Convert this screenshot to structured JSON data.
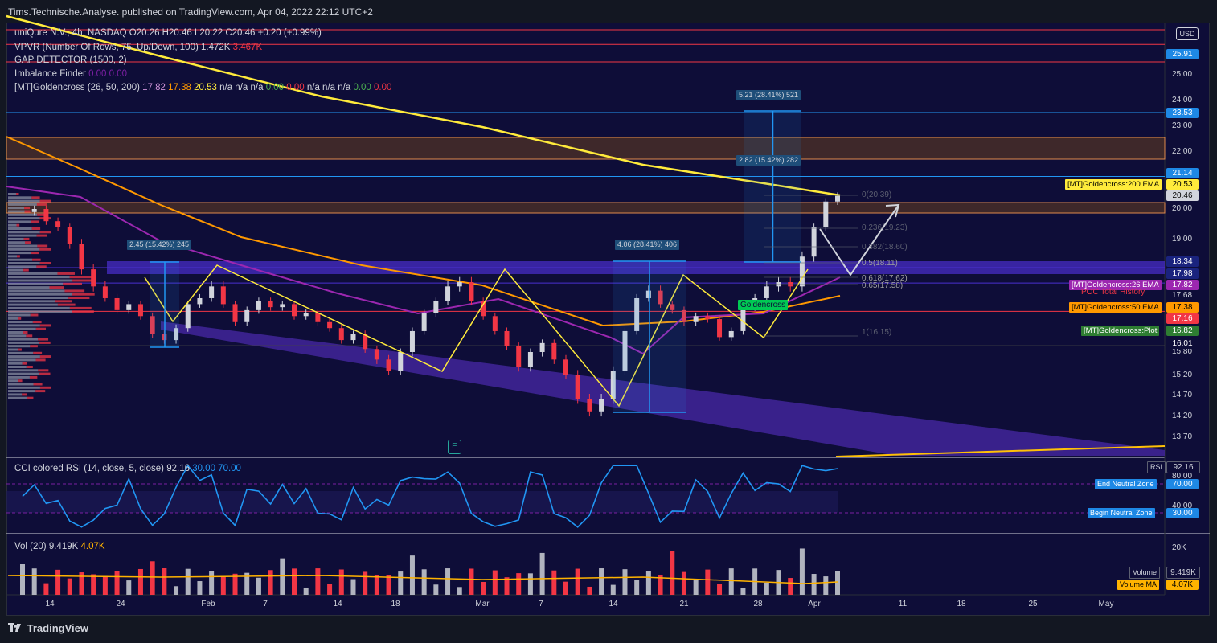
{
  "header": {
    "published": "Tims.Technische.Analyse. published on TradingView.com, Apr 04, 2022 22:12 UTC+2"
  },
  "footer": {
    "brand": "TradingView"
  },
  "legend": {
    "symbol": "uniQure N.V., 4h, NASDAQ",
    "ohlc": "O20.26  H20.46  L20.22  C20.46  +0.20 (+0.99%)",
    "vpvr_label": "VPVR (Number Of Rows, 75, Up/Down, 100)",
    "vpvr_up": "1.472K",
    "vpvr_down": "3.467K",
    "gap": "GAP DETECTOR (1500, 2)",
    "imbalance_label": "Imbalance Finder",
    "imbalance_values": "0.00  0.00",
    "gc_label": "[MT]Goldencross (26, 50, 200)",
    "gc_v1": "17.82",
    "gc_v2": "17.38",
    "gc_v3": "20.53",
    "gc_rest": "n/a  n/a  n/a",
    "gc_v4": "0.00",
    "gc_v5": "0.00",
    "gc_rest2": "n/a  n/a  n/a",
    "gc_v6": "0.00",
    "gc_v7": "0.00"
  },
  "rsi_legend": {
    "label": "CCI colored RSI (14, close, 5, close)",
    "v1": "92.16",
    "v2": "30.00",
    "v3": "70.00"
  },
  "vol_legend": {
    "label": "Vol (20)",
    "v1": "9.419K",
    "v2": "4.07K"
  },
  "currency": "USD",
  "price_axis": [
    "25.00",
    "24.00",
    "23.00",
    "22.00",
    "20.00",
    "19.00",
    "17.68",
    "15.80",
    "15.20",
    "14.70",
    "14.20",
    "13.70"
  ],
  "price_tags": {
    "p2591": "25.91",
    "p2353": "23.53",
    "p2114": "21.14",
    "p2053": "20.53",
    "p2046": "20.46",
    "p1834": "18.34",
    "p1798": "17.98",
    "p1782": "17.82",
    "p1738": "17.38",
    "p1716": "17.16",
    "p1682": "16.82",
    "p1601": "16.01"
  },
  "labels": {
    "gc200": "[MT]Goldencross:200 EMA",
    "gc26": "[MT]Goldencross:26 EMA",
    "gc50": "[MT]Goldencross:50 EMA",
    "gcplot": "[MT]Goldencross:Plot",
    "poc": "POC Total History",
    "goldencross_marker": "Goldencross",
    "e_marker": "E",
    "measure1": "2.45 (15.42%) 245",
    "measure2": "4.06 (28.41%) 406",
    "measure3": "5.21 (28.41%) 521",
    "measure4": "2.82 (15.42%) 282",
    "rsi_tag": "RSI",
    "rsi_value": "92.16",
    "end_zone": "End Neutral Zone",
    "end_zone_val": "70.00",
    "begin_zone": "Begin Neutral Zone",
    "begin_zone_val": "30.00",
    "rsi_axis": [
      "80.00",
      "40.00"
    ],
    "vol_axis_top": "20K",
    "volume_tag": "Volume",
    "volume_val": "9.419K",
    "volume_ma_tag": "Volume MA",
    "volume_ma_val": "4.07K"
  },
  "fib_labels": [
    "0(20.39)",
    "0.236(19.23)",
    "0.382(18.60)",
    "0.5(18.11)",
    "0.618(17.62)",
    "0.65(17.58)",
    "1(16.15)"
  ],
  "x_axis": [
    "14",
    "24",
    "Feb",
    "7",
    "14",
    "18",
    "Mar",
    "7",
    "14",
    "21",
    "28",
    "Apr",
    "11",
    "18",
    "25",
    "May"
  ],
  "colors": {
    "bull": "#d1d4dc",
    "bear": "#f23645",
    "ema26": "#9c27b0",
    "ema50": "#ff9800",
    "ema200": "#ffeb3b",
    "zigzag": "#ffeb3b",
    "channel": "#4527a0",
    "measure": "#2196f3",
    "rsi_line": "#2196f3"
  },
  "chart_data": {
    "type": "candlestick",
    "title": "uniQure N.V., 4h, NASDAQ",
    "ylabel": "USD",
    "ylim": [
      13.4,
      26.4
    ],
    "x_ticks": [
      "14",
      "24",
      "Feb",
      "7",
      "14",
      "18",
      "Mar",
      "7",
      "14",
      "21",
      "28",
      "Apr",
      "11",
      "18",
      "25",
      "May"
    ],
    "close_path": [
      19.9,
      20.0,
      19.6,
      19.4,
      18.9,
      18.3,
      17.9,
      17.6,
      17.2,
      17.4,
      17.0,
      16.4,
      16.2,
      16.6,
      17.4,
      17.6,
      17.9,
      17.4,
      16.8,
      17.2,
      17.5,
      17.3,
      17.4,
      17.0,
      17.1,
      16.8,
      16.6,
      16.2,
      16.4,
      15.9,
      15.6,
      15.3,
      15.8,
      16.5,
      17.1,
      17.5,
      17.9,
      18.0,
      17.5,
      17.0,
      16.5,
      16.0,
      15.4,
      15.8,
      16.1,
      15.6,
      15.2,
      14.6,
      14.3,
      14.6,
      15.3,
      16.5,
      17.6,
      17.8,
      17.4,
      17.2,
      16.8,
      17.0,
      16.9,
      16.3,
      16.5,
      17.3,
      17.6,
      17.9,
      18.0,
      17.9,
      18.6,
      19.4,
      20.26,
      20.46
    ],
    "series": [
      {
        "name": "[MT]Goldencross:26 EMA",
        "last": 17.82
      },
      {
        "name": "[MT]Goldencross:50 EMA",
        "last": 17.38
      },
      {
        "name": "[MT]Goldencross:200 EMA",
        "last": 20.53
      }
    ],
    "levels": [
      25.91,
      23.53,
      21.14,
      18.34,
      17.98,
      17.16,
      16.01
    ],
    "rsi": {
      "value": 92.16,
      "upper": 70.0,
      "lower": 30.0
    },
    "volume": {
      "last": "9.419K",
      "ma": "4.07K"
    }
  }
}
